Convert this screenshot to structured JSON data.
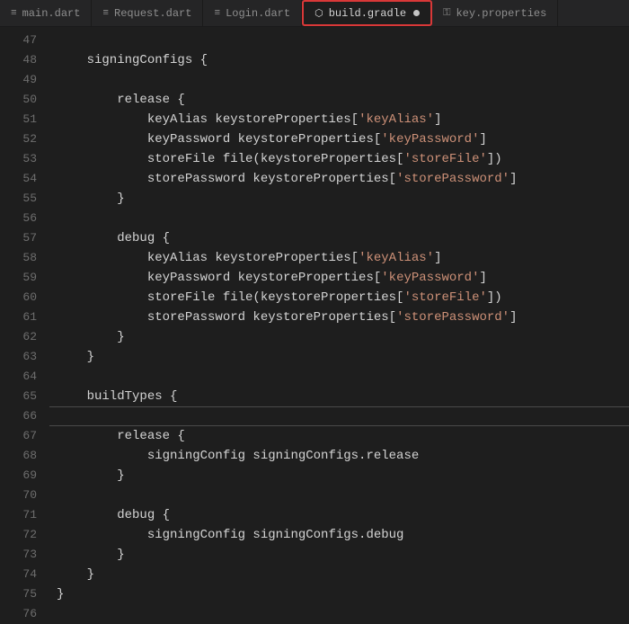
{
  "tabs": [
    {
      "label": "main.dart",
      "icon": "≡",
      "active": false,
      "dirty": false
    },
    {
      "label": "Request.dart",
      "icon": "≡",
      "active": false,
      "dirty": false
    },
    {
      "label": "Login.dart",
      "icon": "≡",
      "active": false,
      "dirty": false
    },
    {
      "label": "build.gradle",
      "icon": "⬡",
      "active": true,
      "dirty": true
    },
    {
      "label": "key.properties",
      "icon": "⚿",
      "active": false,
      "dirty": false
    }
  ],
  "gutterStart": 47,
  "gutterEnd": 76,
  "cursorLine": 66,
  "code": {
    "l47": "",
    "l48_a": "    signingConfigs {",
    "l49": "",
    "l50_a": "        release {",
    "l51_a": "            keyAlias keystoreProperties[",
    "l51_s": "'keyAlias'",
    "l51_b": "]",
    "l52_a": "            keyPassword keystoreProperties[",
    "l52_s": "'keyPassword'",
    "l52_b": "]",
    "l53_a": "            storeFile file(keystoreProperties[",
    "l53_s": "'storeFile'",
    "l53_b": "])",
    "l54_a": "            storePassword keystoreProperties[",
    "l54_s": "'storePassword'",
    "l54_b": "]",
    "l55_a": "        }",
    "l56": "",
    "l57_a": "        debug {",
    "l58_a": "            keyAlias keystoreProperties[",
    "l58_s": "'keyAlias'",
    "l58_b": "]",
    "l59_a": "            keyPassword keystoreProperties[",
    "l59_s": "'keyPassword'",
    "l59_b": "]",
    "l60_a": "            storeFile file(keystoreProperties[",
    "l60_s": "'storeFile'",
    "l60_b": "])",
    "l61_a": "            storePassword keystoreProperties[",
    "l61_s": "'storePassword'",
    "l61_b": "]",
    "l62_a": "        }",
    "l63_a": "    }",
    "l64": "",
    "l65_a": "    buildTypes {",
    "l66": "",
    "l67_a": "        release {",
    "l68_a": "            signingConfig signingConfigs.release",
    "l69_a": "        }",
    "l70": "",
    "l71_a": "        debug {",
    "l72_a": "            signingConfig signingConfigs.debug",
    "l73_a": "        }",
    "l74_a": "    }",
    "l75_a": "}",
    "l76": ""
  }
}
